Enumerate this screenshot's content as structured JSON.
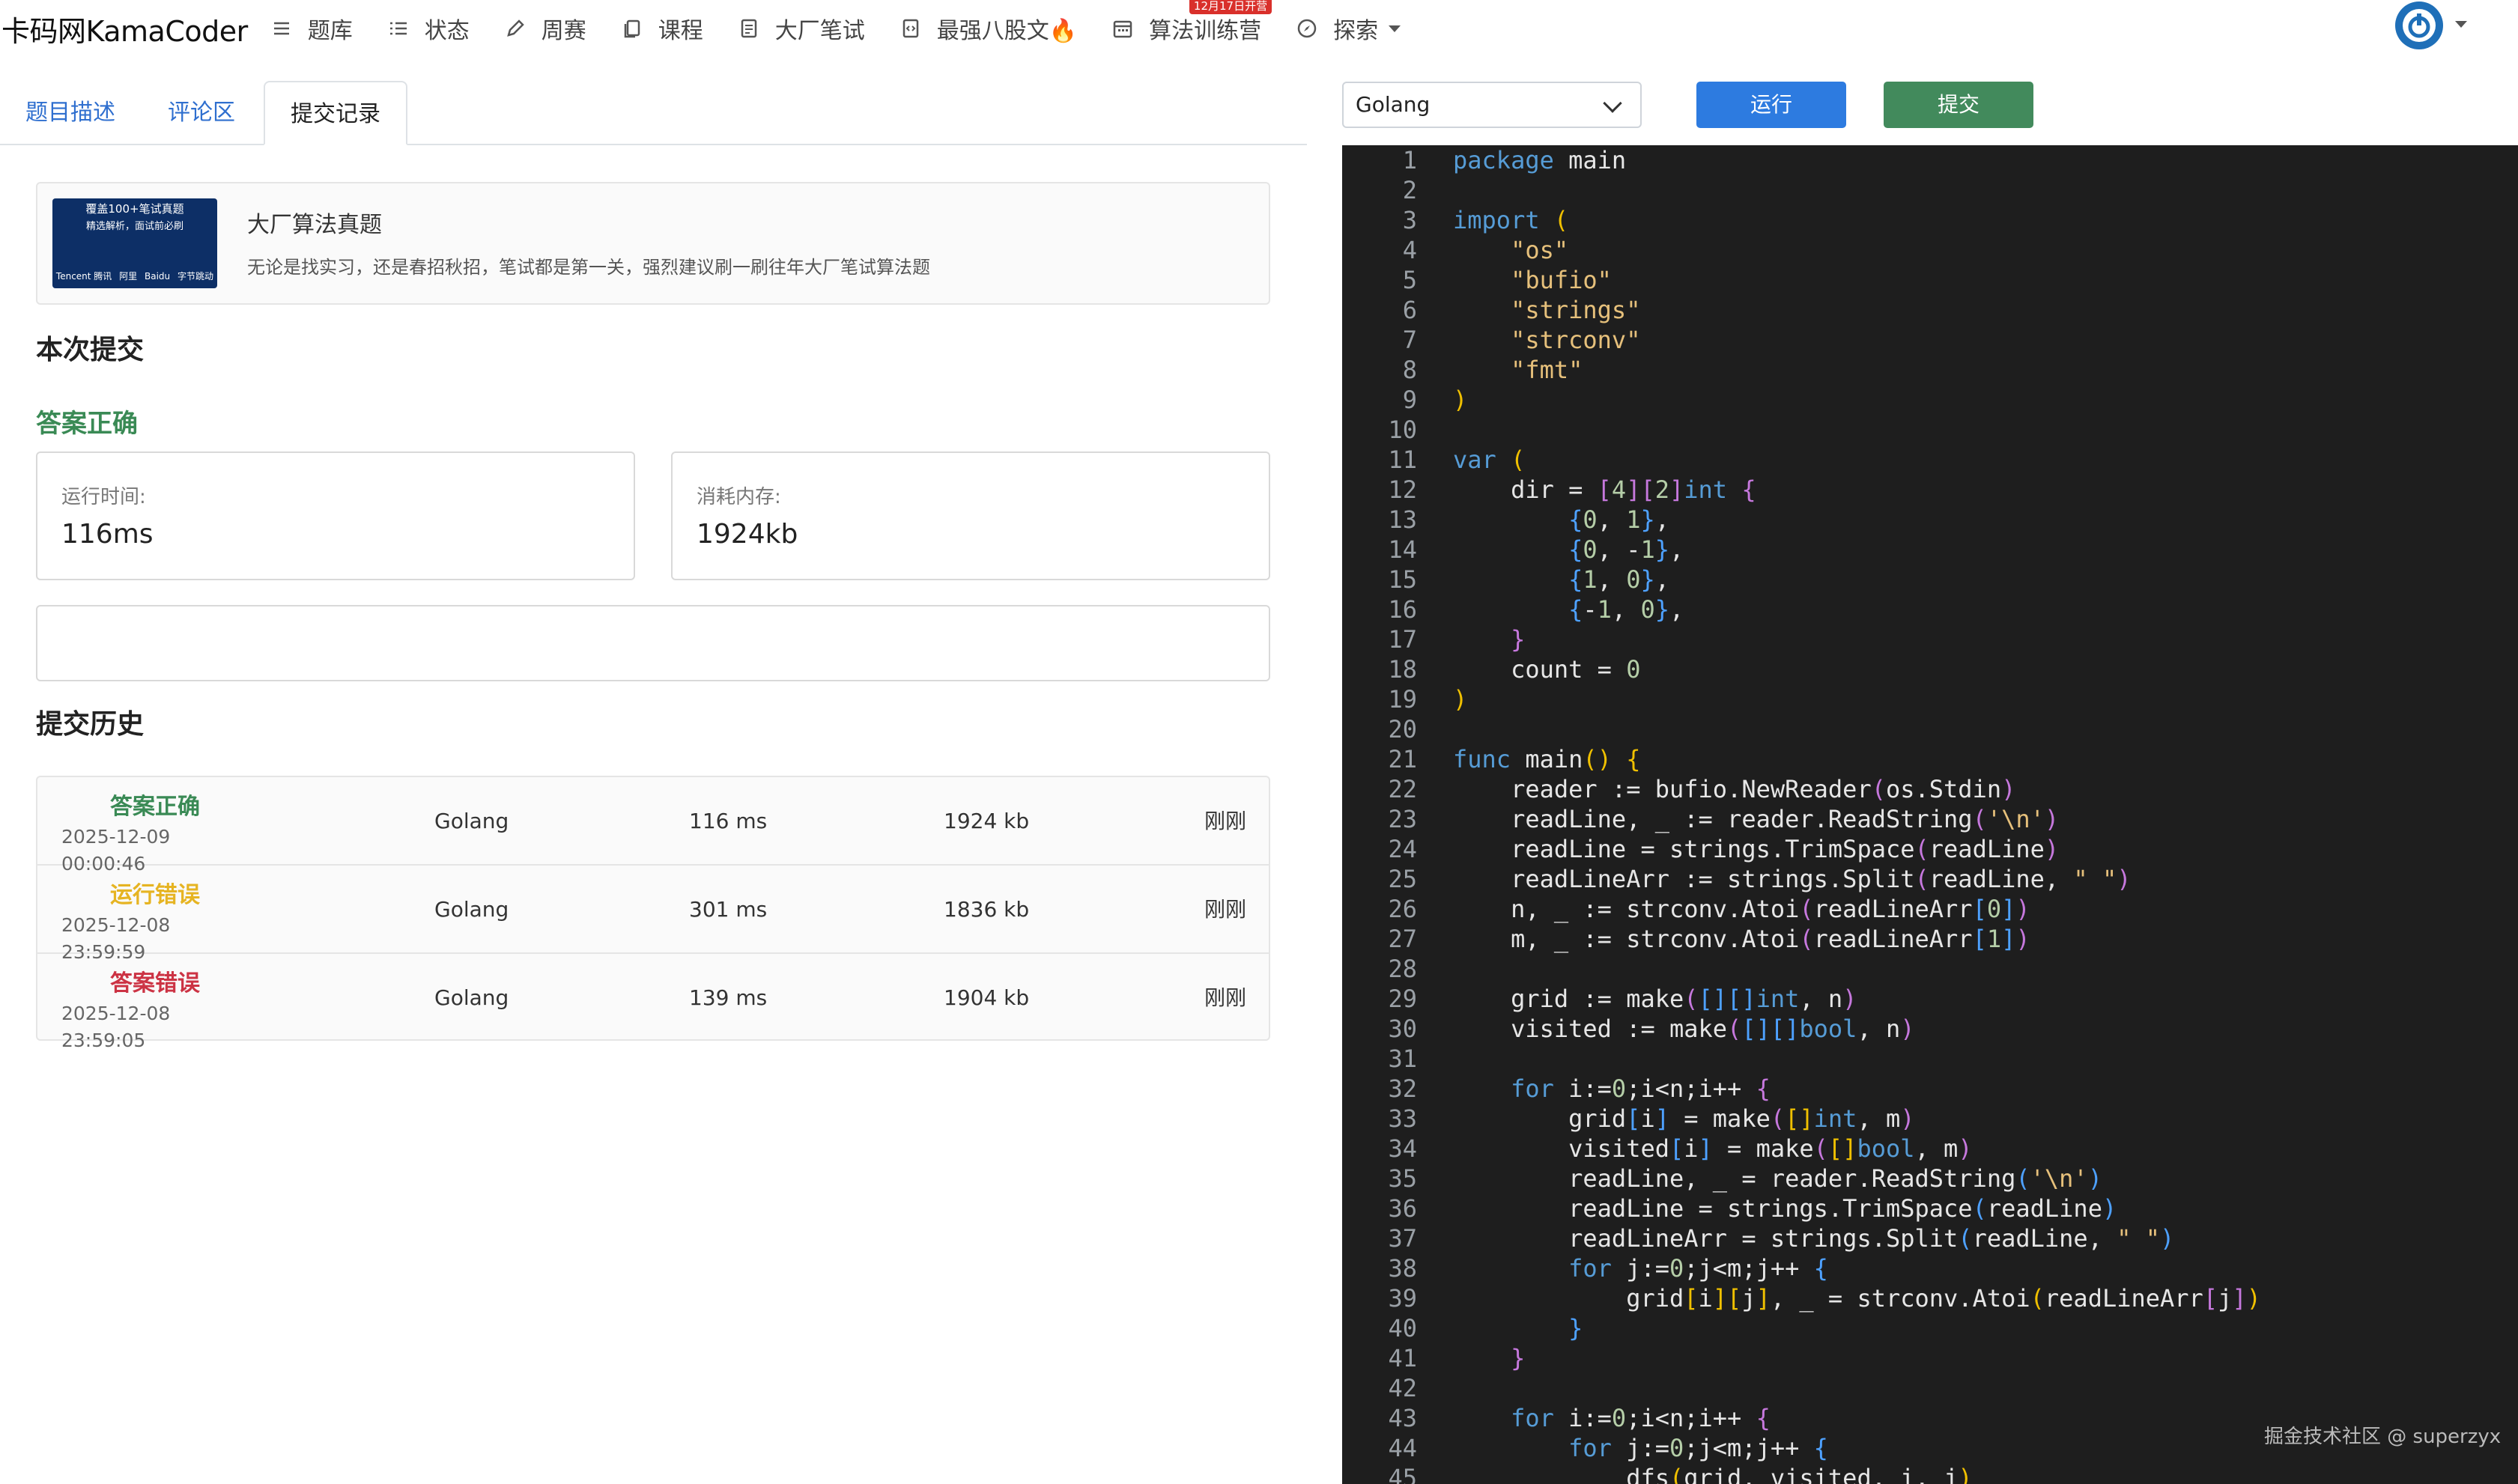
{
  "brand": "卡码网KamaCoder",
  "nav": [
    {
      "label": "题库",
      "icon": "list-icon"
    },
    {
      "label": "状态",
      "icon": "checklist-icon"
    },
    {
      "label": "周赛",
      "icon": "pen-icon"
    },
    {
      "label": "课程",
      "icon": "copy-icon"
    },
    {
      "label": "大厂笔试",
      "icon": "document-icon"
    },
    {
      "label": "最强八股文🔥",
      "icon": "code-doc-icon"
    },
    {
      "label": "算法训练营",
      "icon": "calendar-icon",
      "badge": "12月17日开营"
    },
    {
      "label": "探索",
      "icon": "compass-icon"
    }
  ],
  "tabs": [
    {
      "label": "题目描述"
    },
    {
      "label": "评论区"
    },
    {
      "label": "提交记录"
    }
  ],
  "promo": {
    "title": "大厂算法真题",
    "desc": "无论是找实习，还是春招秋招，笔试都是第一关，强烈建议刷一刷往年大厂笔试算法题",
    "img_line1": "覆盖100+笔试真题",
    "img_line2": "精选解析，面试前必刷",
    "img_logos": [
      "Tencent 腾讯",
      "阿里",
      "Baidu",
      "字节跳动"
    ]
  },
  "submission": {
    "heading": "本次提交",
    "result": "答案正确",
    "runtime_label": "运行时间:",
    "runtime_value": "116ms",
    "memory_label": "消耗内存:",
    "memory_value": "1924kb"
  },
  "history": {
    "heading": "提交历史",
    "rows": [
      {
        "status": "答案正确",
        "status_color": "#3a8a55",
        "date": "2025-12-09 00:00:46",
        "lang": "Golang",
        "time": "116 ms",
        "mem": "1924 kb",
        "when": "刚刚"
      },
      {
        "status": "运行错误",
        "status_color": "#e6b422",
        "date": "2025-12-08 23:59:59",
        "lang": "Golang",
        "time": "301 ms",
        "mem": "1836 kb",
        "when": "刚刚"
      },
      {
        "status": "答案错误",
        "status_color": "#cc3344",
        "date": "2025-12-08 23:59:05",
        "lang": "Golang",
        "time": "139 ms",
        "mem": "1904 kb",
        "when": "刚刚"
      }
    ]
  },
  "editor": {
    "language": "Golang",
    "run_label": "运行",
    "submit_label": "提交",
    "lines": [
      "<span class=\"kw\">package</span> main",
      "",
      "<span class=\"kw\">import</span> <span class=\"par\">(</span>",
      "    <span class=\"str\">\"os\"</span>",
      "    <span class=\"str\">\"bufio\"</span>",
      "    <span class=\"str\">\"strings\"</span>",
      "    <span class=\"str\">\"strconv\"</span>",
      "    <span class=\"str\">\"fmt\"</span>",
      "<span class=\"par\">)</span>",
      "",
      "<span class=\"kw\">var</span> <span class=\"par\">(</span>",
      "    dir = <span class=\"brk\">[</span><span class=\"num\">4</span><span class=\"brk\">][</span><span class=\"num\">2</span><span class=\"brk\">]</span><span class=\"kw\">int</span> <span class=\"brk\">{</span>",
      "        <span class=\"sq\">{</span><span class=\"num\">0</span>, <span class=\"num\">1</span><span class=\"sq\">}</span>,",
      "        <span class=\"sq\">{</span><span class=\"num\">0</span>, -<span class=\"num\">1</span><span class=\"sq\">}</span>,",
      "        <span class=\"sq\">{</span><span class=\"num\">1</span>, <span class=\"num\">0</span><span class=\"sq\">}</span>,",
      "        <span class=\"sq\">{</span>-<span class=\"num\">1</span>, <span class=\"num\">0</span><span class=\"sq\">}</span>,",
      "    <span class=\"brk\">}</span>",
      "    count = <span class=\"num\">0</span>",
      "<span class=\"par\">)</span>",
      "",
      "<span class=\"kw\">func</span> main<span class=\"par\">()</span> <span class=\"par\">{</span>",
      "    reader := bufio.NewReader<span class=\"brk\">(</span>os.Stdin<span class=\"brk\">)</span>",
      "    readLine, _ := reader.ReadString<span class=\"brk\">(</span><span class=\"str\">'\\n'</span><span class=\"brk\">)</span>",
      "    readLine = strings.TrimSpace<span class=\"brk\">(</span>readLine<span class=\"brk\">)</span>",
      "    readLineArr := strings.Split<span class=\"brk\">(</span>readLine, <span class=\"str\">\" \"</span><span class=\"brk\">)</span>",
      "    n, _ := strconv.Atoi<span class=\"brk\">(</span>readLineArr<span class=\"sq\">[</span><span class=\"num\">0</span><span class=\"sq\">]</span><span class=\"brk\">)</span>",
      "    m, _ := strconv.Atoi<span class=\"brk\">(</span>readLineArr<span class=\"sq\">[</span><span class=\"num\">1</span><span class=\"sq\">]</span><span class=\"brk\">)</span>",
      "",
      "    grid := make<span class=\"brk\">(</span><span class=\"sq\">[][]</span><span class=\"kw\">int</span>, n<span class=\"brk\">)</span>",
      "    visited := make<span class=\"brk\">(</span><span class=\"sq\">[][]</span><span class=\"kw\">bool</span>, n<span class=\"brk\">)</span>",
      "",
      "    <span class=\"kw\">for</span> i:=<span class=\"num\">0</span>;i&lt;n;i++ <span class=\"brk\">{</span>",
      "        grid<span class=\"sq\">[</span>i<span class=\"sq\">]</span> = make<span class=\"brk\">(</span><span class=\"par\">[]</span><span class=\"kw\">int</span>, m<span class=\"brk\">)</span>",
      "        visited<span class=\"sq\">[</span>i<span class=\"sq\">]</span> = make<span class=\"brk\">(</span><span class=\"par\">[]</span><span class=\"kw\">bool</span>, m<span class=\"brk\">)</span>",
      "        readLine, _ = reader.ReadString<span class=\"sq\">(</span><span class=\"str\">'\\n'</span><span class=\"sq\">)</span>",
      "        readLine = strings.TrimSpace<span class=\"sq\">(</span>readLine<span class=\"sq\">)</span>",
      "        readLineArr = strings.Split<span class=\"sq\">(</span>readLine, <span class=\"str\">\" \"</span><span class=\"sq\">)</span>",
      "        <span class=\"kw\">for</span> j:=<span class=\"num\">0</span>;j&lt;m;j++ <span class=\"sq\">{</span>",
      "            grid<span class=\"par\">[</span>i<span class=\"par\">][</span>j<span class=\"par\">]</span>, _ = strconv.Atoi<span class=\"par\">(</span>readLineArr<span class=\"brk\">[</span>j<span class=\"brk\">]</span><span class=\"par\">)</span>",
      "        <span class=\"sq\">}</span>",
      "    <span class=\"brk\">}</span>",
      "",
      "    <span class=\"kw\">for</span> i:=<span class=\"num\">0</span>;i&lt;n;i++ <span class=\"brk\">{</span>",
      "        <span class=\"kw\">for</span> j:=<span class=\"num\">0</span>;j&lt;m;j++ <span class=\"sq\">{</span>",
      "            dfs<span class=\"par\">(</span>grid, visited, i, j<span class=\"par\">)</span>"
    ]
  },
  "watermark": "掘金技术社区 @ superzyx"
}
